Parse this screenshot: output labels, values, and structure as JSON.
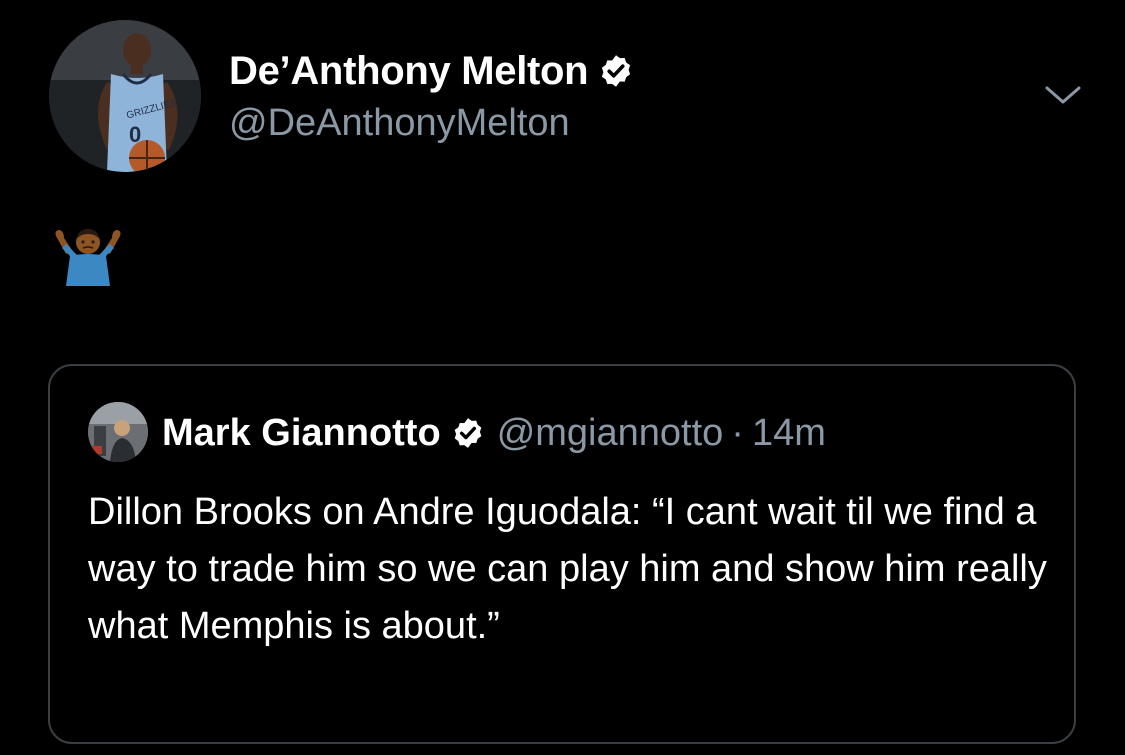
{
  "tweet": {
    "author": {
      "name": "De’Anthony Melton",
      "handle": "@DeAnthonyMelton",
      "verified": true,
      "avatar_icon": "player-avatar"
    },
    "text": "🤷🏾‍♂️",
    "emoji_icon": "man-shrugging-icon",
    "menu_icon": "chevron-down-icon"
  },
  "quoted_tweet": {
    "author": {
      "name": "Mark Giannotto",
      "handle": "@mgiannotto",
      "verified": true,
      "avatar_icon": "user-avatar"
    },
    "separator": "·",
    "time": "14m",
    "text": "Dillon Brooks on Andre Iguodala: “I cant wait til we find a way to trade him so we can play him and show him really what Memphis is about.”"
  },
  "colors": {
    "background": "#000000",
    "text_primary": "#ffffff",
    "text_secondary": "#8b98a5",
    "verified_badge": "#ffffff",
    "card_border": "#3a3f44"
  }
}
